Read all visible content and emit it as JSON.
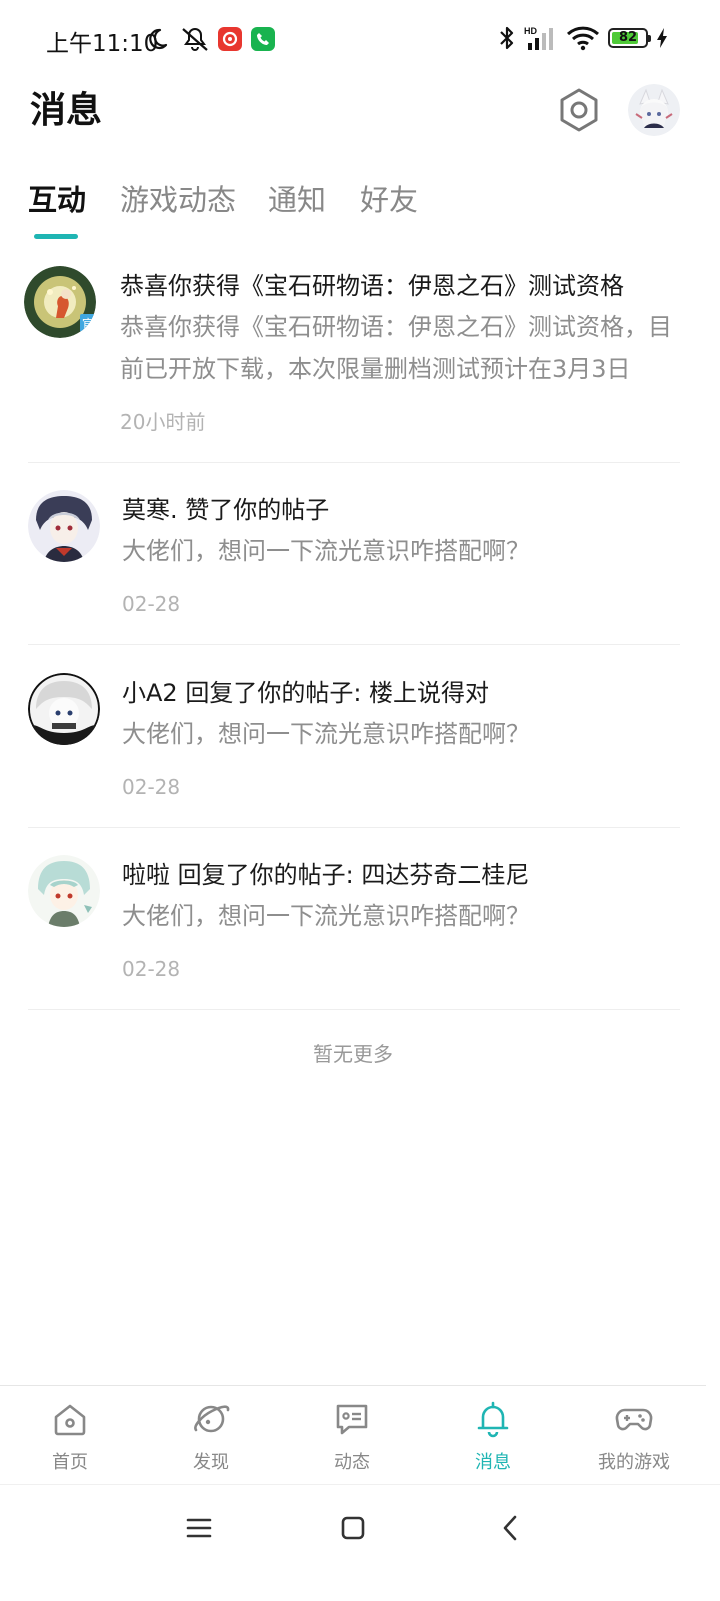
{
  "status_bar": {
    "time": "上午11:10",
    "battery": "82",
    "battery_level": 0.82,
    "icons": [
      "moon-icon",
      "mute-icon",
      "netease-music-app-icon",
      "phone-app-icon",
      "bluetooth-icon",
      "hd-signal-icon",
      "wifi-icon",
      "battery-icon",
      "charging-icon"
    ]
  },
  "header": {
    "title": "消息",
    "settings_icon": "settings-hexagon-icon"
  },
  "tabs": [
    {
      "label": "互动",
      "active": true
    },
    {
      "label": "游戏动态",
      "active": false
    },
    {
      "label": "通知",
      "active": false
    },
    {
      "label": "好友",
      "active": false
    }
  ],
  "messages": [
    {
      "title": "恭喜你获得《宝石研物语：伊恩之石》测试资格",
      "preview": "恭喜你获得《宝石研物语：伊恩之石》测试资格，目前已开放下载，本次限量删档测试预计在3月3日",
      "time": "20小时前"
    },
    {
      "title": "莫寒. 赞了你的帖子",
      "preview": "大佬们，想问一下流光意识咋搭配啊？",
      "time": "02-28"
    },
    {
      "title": "小A2 回复了你的帖子: 楼上说得对",
      "preview": "大佬们，想问一下流光意识咋搭配啊？",
      "time": "02-28"
    },
    {
      "title": "啦啦 回复了你的帖子: 四达芬奇二桂尼",
      "preview": "大佬们，想问一下流光意识咋搭配啊？",
      "time": "02-28"
    }
  ],
  "no_more": "暂无更多",
  "bottom_nav": [
    {
      "label": "首页",
      "icon": "home-icon",
      "active": false
    },
    {
      "label": "发现",
      "icon": "planet-icon",
      "active": false
    },
    {
      "label": "动态",
      "icon": "chat-bubble-icon",
      "active": false
    },
    {
      "label": "消息",
      "icon": "bell-icon",
      "active": true
    },
    {
      "label": "我的游戏",
      "icon": "gamepad-icon",
      "active": false
    }
  ],
  "colors": {
    "accent": "#1fb5b3",
    "text_primary": "#1a1a1a",
    "text_secondary": "#8e8e8e",
    "text_muted": "#b3b3b3"
  }
}
